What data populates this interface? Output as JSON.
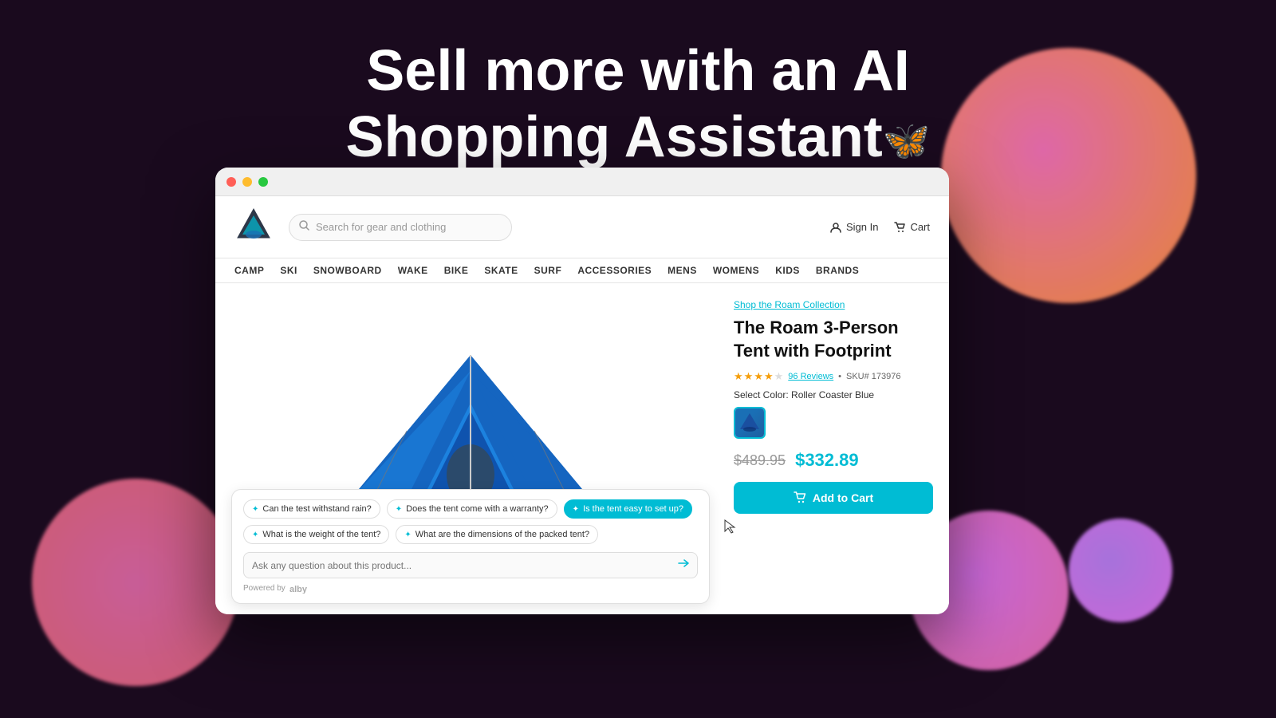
{
  "hero": {
    "line1": "Sell more with an AI",
    "line2": "Shopping Assistant",
    "icon": "🦋"
  },
  "browser": {
    "nav": {
      "search_placeholder": "Search for gear and clothing",
      "sign_in": "Sign In",
      "cart": "Cart"
    },
    "menu": {
      "items": [
        "CAMP",
        "SKI",
        "SNOWBOARD",
        "WAKE",
        "BIKE",
        "SKATE",
        "SURF",
        "ACCESSORIES",
        "MENS",
        "WOMENS",
        "KIDS",
        "BRANDS"
      ]
    },
    "product": {
      "collection_link": "Shop the Roam Collection",
      "title": "The Roam 3-Person Tent with Footprint",
      "reviews_count": "96 Reviews",
      "sku": "SKU# 173976",
      "color_label": "Select Color: Roller Coaster Blue",
      "price_original": "$489.95",
      "price_sale": "$332.89",
      "add_to_cart": "Add to Cart"
    },
    "chat": {
      "suggestions": [
        "Can the test withstand rain?",
        "Does the tent come with a warranty?",
        "Is the tent easy to set up?",
        "What is the weight of the tent?",
        "What are the dimensions of the packed tent?"
      ],
      "active_suggestion": "Is the tent easy to set up?",
      "placeholder": "Ask any question about this product...",
      "powered_by": "Powered by",
      "brand": "alby"
    }
  }
}
